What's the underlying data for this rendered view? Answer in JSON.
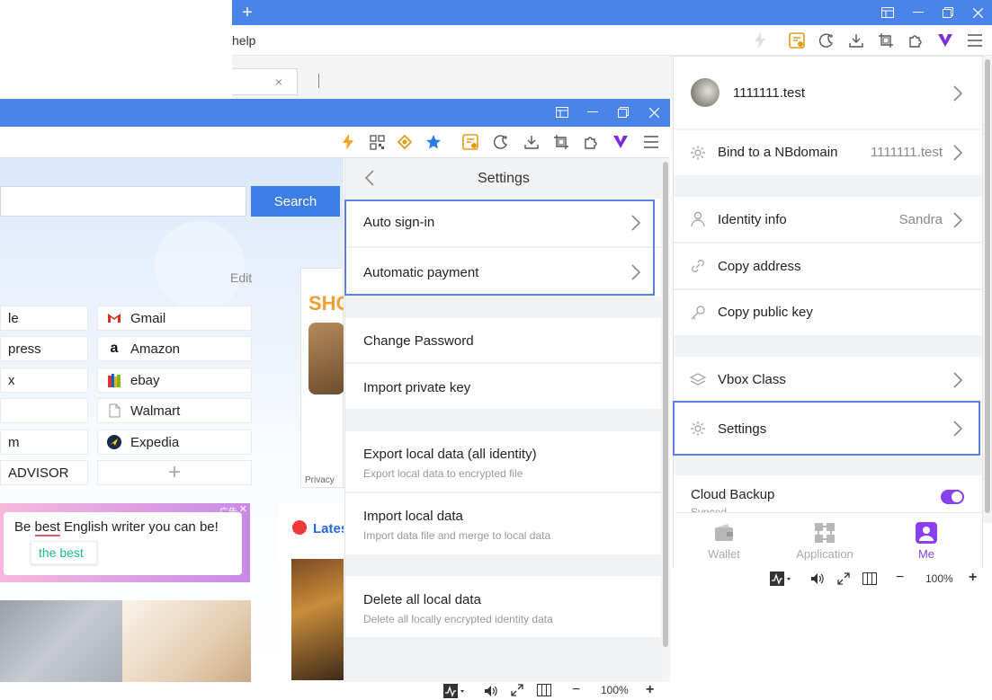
{
  "back_window": {
    "menu_text": "help",
    "new_tab_symbol": "+",
    "tab_close": "×",
    "toolbar_icons": [
      "bolt-icon",
      "coupon-icon",
      "moon-icon",
      "download-icon",
      "crop-icon",
      "extension-icon",
      "vbox-icon",
      "menu-icon"
    ]
  },
  "front_window": {
    "search_button": "Search",
    "edit_label": "Edit",
    "quick_links_left": [
      "le",
      "press",
      "x",
      "",
      "m",
      "ADVISOR"
    ],
    "quick_links_right": [
      {
        "label": "Gmail",
        "icon": "gmail-icon"
      },
      {
        "label": "Amazon",
        "icon": "amazon-icon"
      },
      {
        "label": "ebay",
        "icon": "ebay-icon"
      },
      {
        "label": "Walmart",
        "icon": "file-icon"
      },
      {
        "label": "Expedia",
        "icon": "expedia-icon"
      }
    ],
    "add_tile": "+",
    "ad_label": "广告",
    "ad_text": "Be best English writer you can be!",
    "ad_suggestion": "the best",
    "ad_highlight": "best",
    "shop_text": "SHO",
    "privacy_label": "Privacy",
    "latest_label": "Lates"
  },
  "settings_panel": {
    "title": "Settings",
    "groups": [
      [
        {
          "title": "Auto sign-in",
          "chevron": true
        },
        {
          "title": "Automatic payment",
          "chevron": true
        }
      ],
      [
        {
          "title": "Change Password"
        },
        {
          "title": "Import private key"
        }
      ],
      [
        {
          "title": "Export local data (all identity)",
          "subtitle": "Export local data to encrypted file"
        },
        {
          "title": "Import local data",
          "subtitle": "Import data file and merge to local data"
        }
      ],
      [
        {
          "title": "Delete all local data",
          "subtitle": "Delete all locally encrypted identity data"
        }
      ]
    ]
  },
  "right_panel": {
    "account_name": "1111111.test",
    "bind_label": "Bind to a NBdomain",
    "bind_value": "1111111.test",
    "identity_label": "Identity info",
    "identity_value": "Sandra",
    "copy_address": "Copy address",
    "copy_public_key": "Copy public key",
    "vbox_class": "Vbox Class",
    "settings": "Settings",
    "cloud_backup": "Cloud Backup",
    "cloud_backup_status": "Synced",
    "cloud_backup_enabled": true,
    "nav": {
      "wallet": "Wallet",
      "application": "Application",
      "me": "Me"
    }
  },
  "status_bar": {
    "zoom": "100%",
    "minus": "−",
    "plus": "+"
  },
  "colors": {
    "titlebar": "#4a84e8",
    "accent_purple": "#8a3ff0",
    "highlight_border": "#5b7fe6"
  }
}
